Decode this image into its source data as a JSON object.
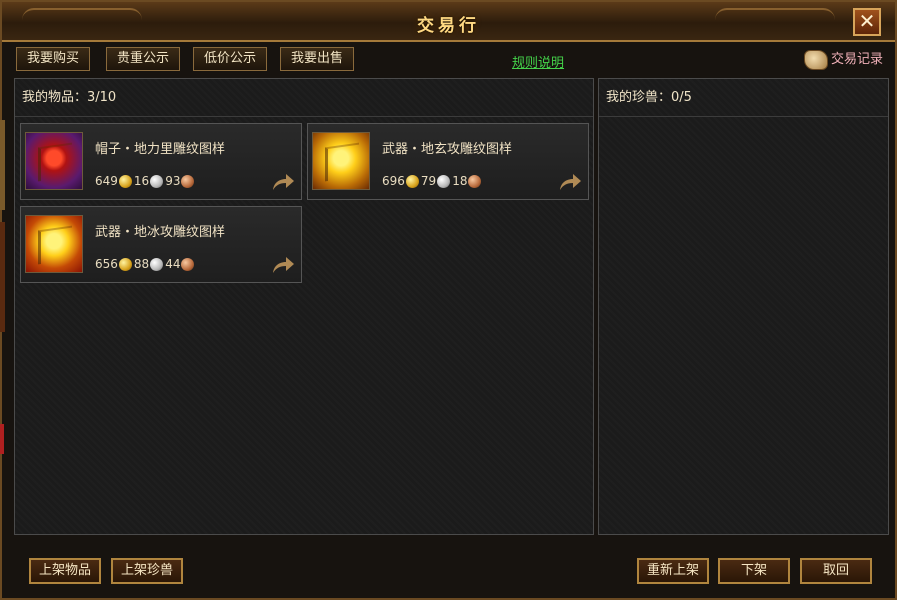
{
  "window": {
    "title": "交易行",
    "close_label": "✕"
  },
  "tabs": [
    {
      "label": "我要购买"
    },
    {
      "label": "贵重公示"
    },
    {
      "label": "低价公示"
    },
    {
      "label": "我要出售"
    }
  ],
  "rules_link": "规则说明",
  "trade_log": "交易记录",
  "items_panel": {
    "label": "我的物品：3/10"
  },
  "pets_panel": {
    "label": "我的珍兽：0/5"
  },
  "items": [
    {
      "name": "帽子・地力里雕纹图样",
      "gold": "649",
      "silver": "16",
      "copper": "93",
      "icon": "red-flag-icon"
    },
    {
      "name": "武器・地玄攻雕纹图样",
      "gold": "696",
      "silver": "79",
      "copper": "18",
      "icon": "gold-flag-icon"
    },
    {
      "name": "武器・地冰攻雕纹图样",
      "gold": "656",
      "silver": "88",
      "copper": "44",
      "icon": "gold-flag-icon"
    }
  ],
  "buttons": {
    "list_item": "上架物品",
    "list_pet": "上架珍兽",
    "relist": "重新上架",
    "delist": "下架",
    "cancel": "取回"
  }
}
